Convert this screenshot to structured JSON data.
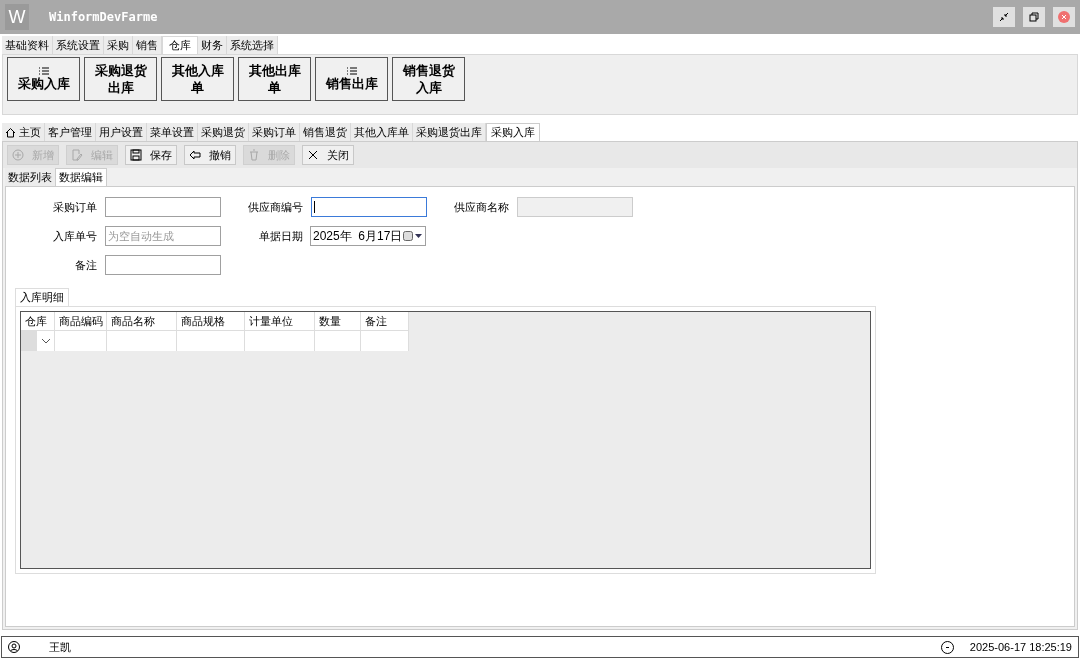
{
  "window": {
    "title": "WinformDevFarme",
    "logo": "W"
  },
  "menu_tabs": [
    {
      "label": "基础资料",
      "selected": false
    },
    {
      "label": "系统设置",
      "selected": false
    },
    {
      "label": "采购",
      "selected": false
    },
    {
      "label": "销售",
      "selected": false
    },
    {
      "label": "仓库",
      "selected": true
    },
    {
      "label": "财务",
      "selected": false
    },
    {
      "label": "系统选择",
      "selected": false
    }
  ],
  "ribbon_buttons": [
    {
      "label": "采购入库",
      "icon": true
    },
    {
      "label": "采购退货出库",
      "icon": false
    },
    {
      "label": "其他入库单",
      "icon": false
    },
    {
      "label": "其他出库单",
      "icon": false
    },
    {
      "label": "销售出库",
      "icon": true
    },
    {
      "label": "销售退货入库",
      "icon": false
    }
  ],
  "doc_tabs": [
    {
      "label": "主页",
      "kind": "home",
      "selected": false
    },
    {
      "label": "客户管理",
      "kind": "plain",
      "selected": false
    },
    {
      "label": "用户设置",
      "kind": "plain",
      "selected": false
    },
    {
      "label": "菜单设置",
      "kind": "plain",
      "selected": false
    },
    {
      "label": "采购退货",
      "kind": "plain",
      "selected": false
    },
    {
      "label": "采购订单",
      "kind": "plain",
      "selected": false
    },
    {
      "label": "销售退货",
      "kind": "plain",
      "selected": false
    },
    {
      "label": "其他入库单",
      "kind": "plain",
      "selected": false
    },
    {
      "label": "采购退货出库",
      "kind": "plain",
      "selected": false
    },
    {
      "label": "采购入库",
      "kind": "plain",
      "selected": true
    }
  ],
  "toolbar": [
    {
      "label": "新增",
      "kind": "add",
      "disabled": true
    },
    {
      "label": "编辑",
      "kind": "edit",
      "disabled": true
    },
    {
      "label": "保存",
      "kind": "save",
      "disabled": false
    },
    {
      "label": "撤销",
      "kind": "undo",
      "disabled": false
    },
    {
      "label": "删除",
      "kind": "delete",
      "disabled": true
    },
    {
      "label": "关闭",
      "kind": "close",
      "disabled": false
    }
  ],
  "sub_tabs": [
    {
      "label": "数据列表",
      "selected": false
    },
    {
      "label": "数据编辑",
      "selected": true
    }
  ],
  "form_rows": [
    [
      {
        "label": "采购订单",
        "kind": "text",
        "disabled": false,
        "focused": false
      },
      {
        "label": "供应商编号",
        "kind": "text",
        "disabled": false,
        "focused": true
      },
      {
        "label": "供应商名称",
        "kind": "text",
        "disabled": true,
        "focused": false
      }
    ],
    [
      {
        "label": "入库单号",
        "kind": "text",
        "placeholder": "为空自动生成",
        "disabled": false,
        "focused": false
      },
      {
        "label": "单据日期",
        "kind": "date",
        "value": "2025年  6月17日",
        "disabled": false,
        "focused": false
      }
    ],
    [
      {
        "label": "备注",
        "kind": "text",
        "disabled": false,
        "focused": false
      }
    ]
  ],
  "detail_tab": {
    "label": "入库明细",
    "selected": true
  },
  "grid": {
    "columns": [
      "仓库",
      "商品编码",
      "商品名称",
      "商品规格",
      "计量单位",
      "数量",
      "备注"
    ]
  },
  "status_bar": {
    "user": "王凯",
    "datetime": "2025-06-17 18:25:19"
  }
}
